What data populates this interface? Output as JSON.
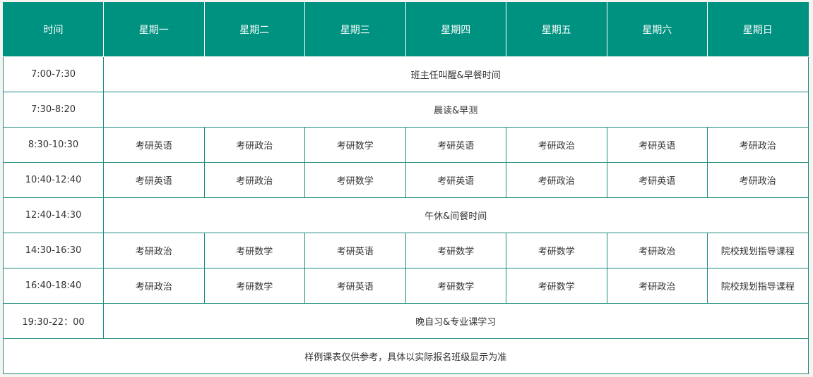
{
  "header": {
    "time_label": "时间",
    "days": [
      "星期一",
      "星期二",
      "星期三",
      "星期四",
      "星期五",
      "星期六",
      "星期日"
    ]
  },
  "rows": [
    {
      "time": "7:00-7:30",
      "span_text": "班主任叫醒&早餐时间"
    },
    {
      "time": "7:30-8:20",
      "span_text": "晨读&早测"
    },
    {
      "time": "8:30-10:30",
      "cells": [
        "考研英语",
        "考研政治",
        "考研数学",
        "考研英语",
        "考研政治",
        "考研英语",
        "考研政治"
      ]
    },
    {
      "time": "10:40-12:40",
      "cells": [
        "考研英语",
        "考研政治",
        "考研数学",
        "考研英语",
        "考研政治",
        "考研英语",
        "考研政治"
      ]
    },
    {
      "time": "12:40-14:30",
      "span_text": "午休&间餐时间"
    },
    {
      "time": "14:30-16:30",
      "cells": [
        "考研政治",
        "考研数学",
        "考研英语",
        "考研数学",
        "考研数学",
        "考研政治",
        "院校规划指导课程"
      ]
    },
    {
      "time": "16:40-18:40",
      "cells": [
        "考研政治",
        "考研数学",
        "考研英语",
        "考研数学",
        "考研数学",
        "考研政治",
        "院校规划指导课程"
      ]
    },
    {
      "time": "19:30-22：00",
      "span_text": "晚自习&专业课学习"
    }
  ],
  "footer_note": "样例课表仅供参考，具体以实际报名班级显示为准",
  "colors": {
    "header_bg": "#009280",
    "header_text": "#ffffff",
    "border": "#1f8d7e",
    "body_text": "#333333"
  }
}
